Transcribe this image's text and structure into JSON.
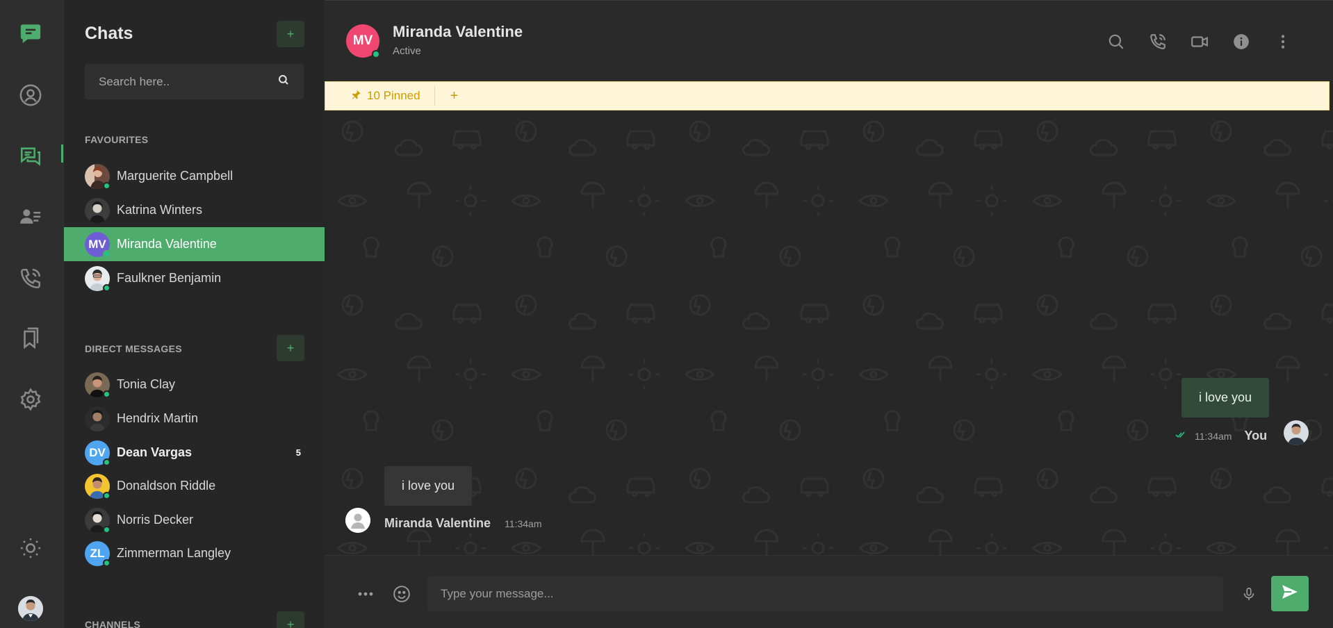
{
  "colors": {
    "accent": "#4eac6d",
    "online": "#26c281",
    "pinned_bg": "#fff5d9",
    "pinned_text": "#cd9c00",
    "header_avatar": "#ef476f"
  },
  "rail": {
    "icons": [
      "logo-chat-icon",
      "profile-icon",
      "chats-icon",
      "contacts-icon",
      "calls-icon",
      "bookmarks-icon",
      "settings-icon",
      "theme-toggle-icon"
    ],
    "active": "chats-icon"
  },
  "sidebar": {
    "title": "Chats",
    "add_label": "+",
    "search_placeholder": "Search here..",
    "favourites_label": "FAVOURITES",
    "favourites": [
      {
        "name": "Marguerite Campbell",
        "online": true,
        "avatar": "photo"
      },
      {
        "name": "Katrina Winters",
        "online": false,
        "avatar": "photo"
      },
      {
        "name": "Miranda Valentine",
        "initials": "MV",
        "online": true,
        "active": true,
        "avatar_color": "#6f5ed3"
      },
      {
        "name": "Faulkner Benjamin",
        "online": true,
        "avatar": "photo"
      }
    ],
    "dm_label": "DIRECT MESSAGES",
    "direct_messages": [
      {
        "name": "Tonia Clay",
        "online": true,
        "avatar": "photo"
      },
      {
        "name": "Hendrix Martin",
        "online": false,
        "avatar": "photo"
      },
      {
        "name": "Dean Vargas",
        "initials": "DV",
        "online": true,
        "unread": "5",
        "avatar_color": "#50a5f1"
      },
      {
        "name": "Donaldson Riddle",
        "online": true,
        "avatar": "photo"
      },
      {
        "name": "Norris Decker",
        "online": true,
        "avatar": "photo"
      },
      {
        "name": "Zimmerman Langley",
        "initials": "ZL",
        "online": true,
        "avatar_color": "#50a5f1"
      }
    ],
    "channels_label": "CHANNELS"
  },
  "chat": {
    "contact_initials": "MV",
    "contact_name": "Miranda Valentine",
    "status": "Active",
    "header_icons": [
      "search-icon",
      "voice-call-icon",
      "video-call-icon",
      "info-icon",
      "more-vertical-icon"
    ],
    "pinned_label": "10 Pinned",
    "pinned_add": "+",
    "messages": [
      {
        "direction": "out",
        "text": "i love you",
        "time": "11:34am",
        "sender": "You"
      },
      {
        "direction": "in",
        "text": "i love you",
        "time": "11:34am",
        "sender": "Miranda Valentine"
      }
    ],
    "composer_placeholder": "Type your message..."
  }
}
